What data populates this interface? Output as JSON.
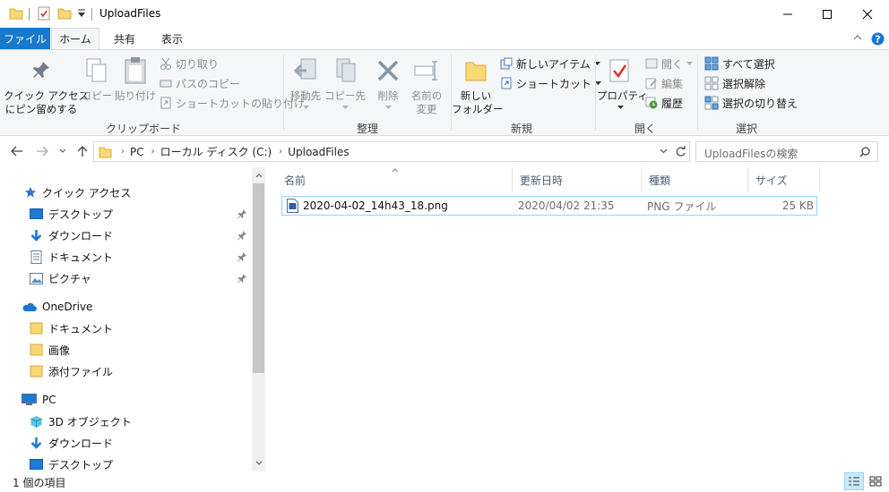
{
  "window": {
    "title": "UploadFiles"
  },
  "ribbon_tabs": [
    {
      "label": "ファイル"
    },
    {
      "label": "ホーム"
    },
    {
      "label": "共有"
    },
    {
      "label": "表示"
    }
  ],
  "ribbon": {
    "clipboard": {
      "group": "クリップボード",
      "pin_line1": "クイック アクセス",
      "pin_line2": "にピン留めする",
      "copy": "コピー",
      "paste": "貼り付け",
      "cut": "切り取り",
      "copy_path": "パスのコピー",
      "paste_shortcut": "ショートカットの貼り付け"
    },
    "organize": {
      "group": "整理",
      "move_to": "移動先",
      "copy_to": "コピー先",
      "delete": "削除",
      "rename_line1": "名前の",
      "rename_line2": "変更"
    },
    "new": {
      "group": "新規",
      "new_folder_line1": "新しい",
      "new_folder_line2": "フォルダー",
      "new_item": "新しいアイテム",
      "shortcut": "ショートカット"
    },
    "open": {
      "group": "開く",
      "properties": "プロパティ",
      "open": "開く",
      "edit": "編集",
      "history": "履歴"
    },
    "select": {
      "group": "選択",
      "select_all": "すべて選択",
      "select_none": "選択解除",
      "invert": "選択の切り替え"
    }
  },
  "address": {
    "crumbs": [
      "PC",
      "ローカル ディスク (C:)",
      "UploadFiles"
    ],
    "search_placeholder": "UploadFilesの検索"
  },
  "nav": {
    "quick_access": "クイック アクセス",
    "quick_items": [
      "デスクトップ",
      "ダウンロード",
      "ドキュメント",
      "ピクチャ"
    ],
    "onedrive": "OneDrive",
    "onedrive_items": [
      "ドキュメント",
      "画像",
      "添付ファイル"
    ],
    "pc": "PC",
    "pc_items": [
      "3D オブジェクト",
      "ダウンロード",
      "デスクトップ"
    ]
  },
  "columns": {
    "name": "名前",
    "modified": "更新日時",
    "type": "種類",
    "size": "サイズ"
  },
  "files": [
    {
      "name": "2020-04-02_14h43_18.png",
      "modified": "2020/04/02 21:35",
      "type": "PNG ファイル",
      "size": "25 KB"
    }
  ],
  "status": {
    "count": "1 個の項目"
  },
  "colors": {
    "accent": "#1979ca",
    "folder": "#f8d775",
    "selection_border": "#99d1ff"
  }
}
